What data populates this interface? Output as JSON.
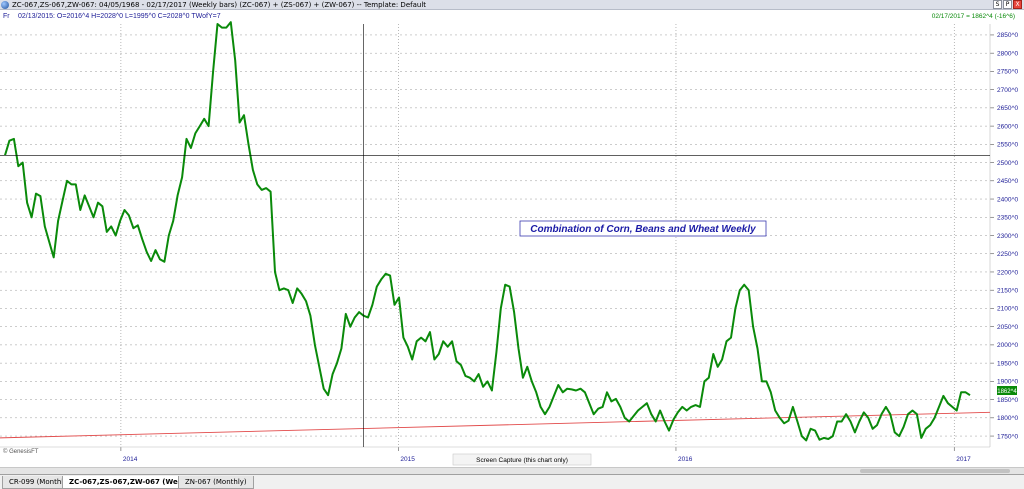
{
  "window": {
    "title": "ZC-067,ZS-067,ZW-067:  04/05/1968 - 02/17/2017  (Weekly bars)  (ZC-067) + (ZS-067) + (ZW-067)  --  Template: Default",
    "buttons": [
      "S",
      "P",
      "X"
    ]
  },
  "info_line": {
    "prefix": "Fr",
    "text": "02/13/2015:  O=2016^4  H=2028^0  L=1995^0  C=2028^0  TWofY=7"
  },
  "corner_readout": "02/17/2017 = 1862^4 (-16^6)",
  "last_price_label": "1862^4",
  "copyright": "© GenesisFT",
  "capture_tooltip": "Screen Capture (this chart only)",
  "tabs": [
    {
      "label": "CR-099 (Monthly)",
      "active": false
    },
    {
      "label": "ZC-067,ZS-067,ZW-067 (Weekly)",
      "active": true
    },
    {
      "label": "ZN-067 (Monthly)",
      "active": false
    }
  ],
  "colors": {
    "price_line": "#0a8a0a",
    "trend_line": "#e24b4b",
    "axis_text": "#1c1c96",
    "annotation_text": "#1a1aa6",
    "crosshair": "#000000"
  },
  "chart_data": {
    "type": "line",
    "title": "Combination of Corn, Beans and Wheat Weekly",
    "xlabel": "",
    "ylabel": "",
    "x_range": [
      "2013-07-26",
      "2017-02-17"
    ],
    "x_ticks": [
      "2014",
      "2015",
      "2016",
      "2017"
    ],
    "x_tick_dates": [
      "2014-01-01",
      "2015-01-01",
      "2016-01-01",
      "2017-01-01"
    ],
    "y_ticks": [
      "1750^0",
      "1800^0",
      "1850^0",
      "1900^0",
      "1950^0",
      "2000^0",
      "2050^0",
      "2100^0",
      "2150^0",
      "2200^0",
      "2250^0",
      "2300^0",
      "2350^0",
      "2400^0",
      "2450^0",
      "2500^0",
      "2550^0",
      "2600^0",
      "2650^0",
      "2700^0",
      "2750^0",
      "2800^0",
      "2850^0"
    ],
    "y_range": [
      1720,
      2880
    ],
    "grid": "dotted vertical at year starts, dashed horizontal at each tick",
    "crosshair": {
      "date": "2015-02-13",
      "value": 2520
    },
    "series": [
      {
        "values": [
          [
            "2013-07-26",
            2520
          ],
          [
            "2013-08-02",
            2560
          ],
          [
            "2013-08-09",
            2565
          ],
          [
            "2013-08-16",
            2490
          ],
          [
            "2013-08-23",
            2500
          ],
          [
            "2013-08-30",
            2390
          ],
          [
            "2013-09-06",
            2350
          ],
          [
            "2013-09-13",
            2415
          ],
          [
            "2013-09-20",
            2408
          ],
          [
            "2013-09-27",
            2325
          ],
          [
            "2013-10-04",
            2282
          ],
          [
            "2013-10-11",
            2240
          ],
          [
            "2013-10-18",
            2340
          ],
          [
            "2013-10-25",
            2395
          ],
          [
            "2013-11-01",
            2450
          ],
          [
            "2013-11-08",
            2440
          ],
          [
            "2013-11-15",
            2440
          ],
          [
            "2013-11-22",
            2370
          ],
          [
            "2013-11-29",
            2410
          ],
          [
            "2013-12-06",
            2380
          ],
          [
            "2013-12-13",
            2350
          ],
          [
            "2013-12-20",
            2390
          ],
          [
            "2013-12-27",
            2380
          ],
          [
            "2014-01-03",
            2310
          ],
          [
            "2014-01-10",
            2325
          ],
          [
            "2014-01-17",
            2300
          ],
          [
            "2014-01-24",
            2340
          ],
          [
            "2014-01-31",
            2370
          ],
          [
            "2014-02-07",
            2355
          ],
          [
            "2014-02-14",
            2320
          ],
          [
            "2014-02-21",
            2328
          ],
          [
            "2014-02-28",
            2290
          ],
          [
            "2014-03-07",
            2255
          ],
          [
            "2014-03-14",
            2230
          ],
          [
            "2014-03-21",
            2260
          ],
          [
            "2014-03-28",
            2235
          ],
          [
            "2014-04-04",
            2228
          ],
          [
            "2014-04-11",
            2300
          ],
          [
            "2014-04-18",
            2340
          ],
          [
            "2014-04-25",
            2410
          ],
          [
            "2014-05-02",
            2460
          ],
          [
            "2014-05-09",
            2565
          ],
          [
            "2014-05-16",
            2540
          ],
          [
            "2014-05-23",
            2580
          ],
          [
            "2014-05-30",
            2600
          ],
          [
            "2014-06-06",
            2620
          ],
          [
            "2014-06-13",
            2600
          ],
          [
            "2014-06-20",
            2750
          ],
          [
            "2014-06-27",
            2880
          ],
          [
            "2014-07-04",
            2870
          ],
          [
            "2014-07-11",
            2870
          ],
          [
            "2014-07-18",
            2885
          ],
          [
            "2014-07-25",
            2780
          ],
          [
            "2014-08-01",
            2610
          ],
          [
            "2014-08-08",
            2630
          ],
          [
            "2014-08-15",
            2550
          ],
          [
            "2014-08-22",
            2480
          ],
          [
            "2014-08-29",
            2440
          ],
          [
            "2014-09-05",
            2425
          ],
          [
            "2014-09-12",
            2430
          ],
          [
            "2014-09-19",
            2420
          ],
          [
            "2014-09-26",
            2200
          ],
          [
            "2014-10-03",
            2150
          ],
          [
            "2014-10-10",
            2155
          ],
          [
            "2014-10-17",
            2150
          ],
          [
            "2014-10-24",
            2115
          ],
          [
            "2014-10-31",
            2155
          ],
          [
            "2014-11-07",
            2140
          ],
          [
            "2014-11-14",
            2120
          ],
          [
            "2014-11-21",
            2080
          ],
          [
            "2014-11-28",
            2000
          ],
          [
            "2014-12-05",
            1940
          ],
          [
            "2014-12-12",
            1880
          ],
          [
            "2014-12-19",
            1862
          ],
          [
            "2014-12-26",
            1920
          ],
          [
            "2015-01-02",
            1950
          ],
          [
            "2015-01-09",
            1990
          ],
          [
            "2015-01-16",
            2085
          ],
          [
            "2015-01-23",
            2050
          ],
          [
            "2015-01-30",
            2075
          ],
          [
            "2015-02-06",
            2090
          ],
          [
            "2015-02-13",
            2080
          ],
          [
            "2015-02-20",
            2075
          ],
          [
            "2015-02-27",
            2110
          ],
          [
            "2015-03-06",
            2160
          ],
          [
            "2015-03-13",
            2180
          ],
          [
            "2015-03-20",
            2195
          ],
          [
            "2015-03-27",
            2190
          ],
          [
            "2015-04-03",
            2110
          ],
          [
            "2015-04-10",
            2130
          ],
          [
            "2015-04-17",
            2020
          ],
          [
            "2015-04-24",
            1995
          ],
          [
            "2015-05-01",
            1960
          ],
          [
            "2015-05-08",
            2010
          ],
          [
            "2015-05-15",
            2020
          ],
          [
            "2015-05-22",
            2010
          ],
          [
            "2015-05-29",
            2035
          ],
          [
            "2015-06-05",
            1960
          ],
          [
            "2015-06-12",
            1975
          ],
          [
            "2015-06-19",
            2010
          ],
          [
            "2015-06-26",
            1995
          ],
          [
            "2015-07-03",
            2010
          ],
          [
            "2015-07-10",
            1955
          ],
          [
            "2015-07-17",
            1945
          ],
          [
            "2015-07-24",
            1915
          ],
          [
            "2015-07-31",
            1910
          ],
          [
            "2015-08-07",
            1900
          ],
          [
            "2015-08-14",
            1920
          ],
          [
            "2015-08-21",
            1885
          ],
          [
            "2015-08-28",
            1900
          ],
          [
            "2015-09-04",
            1875
          ],
          [
            "2015-09-11",
            1980
          ],
          [
            "2015-09-18",
            2100
          ],
          [
            "2015-09-25",
            2165
          ],
          [
            "2015-10-02",
            2160
          ],
          [
            "2015-10-09",
            2090
          ],
          [
            "2015-10-16",
            1990
          ],
          [
            "2015-10-23",
            1910
          ],
          [
            "2015-10-30",
            1940
          ],
          [
            "2015-11-06",
            1900
          ],
          [
            "2015-11-13",
            1870
          ],
          [
            "2015-11-20",
            1830
          ],
          [
            "2015-11-27",
            1810
          ],
          [
            "2015-12-04",
            1830
          ],
          [
            "2015-12-11",
            1860
          ],
          [
            "2015-12-18",
            1890
          ],
          [
            "2015-12-25",
            1870
          ],
          [
            "2016-01-01",
            1880
          ],
          [
            "2016-01-08",
            1878
          ],
          [
            "2016-01-15",
            1875
          ],
          [
            "2016-01-22",
            1880
          ],
          [
            "2016-01-29",
            1870
          ],
          [
            "2016-02-05",
            1840
          ],
          [
            "2016-02-12",
            1810
          ],
          [
            "2016-02-19",
            1825
          ],
          [
            "2016-02-26",
            1830
          ],
          [
            "2016-03-04",
            1870
          ],
          [
            "2016-03-11",
            1845
          ],
          [
            "2016-03-18",
            1852
          ],
          [
            "2016-03-25",
            1830
          ],
          [
            "2016-04-01",
            1800
          ],
          [
            "2016-04-08",
            1790
          ],
          [
            "2016-04-15",
            1805
          ],
          [
            "2016-04-22",
            1820
          ],
          [
            "2016-04-29",
            1830
          ],
          [
            "2016-05-06",
            1840
          ],
          [
            "2016-05-13",
            1810
          ],
          [
            "2016-05-20",
            1790
          ],
          [
            "2016-05-27",
            1820
          ],
          [
            "2016-06-03",
            1790
          ],
          [
            "2016-06-10",
            1765
          ],
          [
            "2016-06-17",
            1795
          ],
          [
            "2016-06-24",
            1815
          ],
          [
            "2016-07-01",
            1830
          ],
          [
            "2016-07-08",
            1820
          ],
          [
            "2016-07-15",
            1830
          ],
          [
            "2016-07-22",
            1835
          ],
          [
            "2016-07-29",
            1830
          ],
          [
            "2016-08-05",
            1900
          ],
          [
            "2016-08-12",
            1910
          ],
          [
            "2016-08-19",
            1975
          ],
          [
            "2016-08-26",
            1940
          ],
          [
            "2016-09-02",
            1960
          ],
          [
            "2016-09-09",
            2010
          ],
          [
            "2016-09-16",
            2020
          ],
          [
            "2016-09-23",
            2100
          ],
          [
            "2016-09-30",
            2150
          ],
          [
            "2016-10-07",
            2165
          ],
          [
            "2016-10-14",
            2150
          ],
          [
            "2016-10-21",
            2050
          ],
          [
            "2016-10-28",
            1990
          ],
          [
            "2016-11-04",
            1900
          ],
          [
            "2016-11-11",
            1900
          ],
          [
            "2016-11-18",
            1870
          ],
          [
            "2016-11-25",
            1820
          ],
          [
            "2016-12-02",
            1800
          ],
          [
            "2016-12-09",
            1785
          ],
          [
            "2016-12-16",
            1792
          ],
          [
            "2016-12-23",
            1830
          ],
          [
            "2016-12-30",
            1790
          ],
          [
            "2017-01-06",
            1750
          ],
          [
            "2017-01-13",
            1738
          ],
          [
            "2017-01-20",
            1770
          ],
          [
            "2017-01-27",
            1765
          ],
          [
            "2017-02-03",
            1740
          ],
          [
            "2017-02-10",
            1745
          ],
          [
            "2017-02-17",
            1742
          ],
          [
            "2017-02-24",
            1750
          ],
          [
            "2017-03-03",
            1790
          ],
          [
            "2017-03-10",
            1790
          ],
          [
            "2017-03-17",
            1810
          ],
          [
            "2017-03-24",
            1790
          ],
          [
            "2017-03-31",
            1760
          ],
          [
            "2017-04-07",
            1790
          ],
          [
            "2017-04-14",
            1815
          ],
          [
            "2017-04-21",
            1800
          ],
          [
            "2017-04-28",
            1770
          ],
          [
            "2017-05-05",
            1780
          ],
          [
            "2017-05-12",
            1810
          ],
          [
            "2017-05-19",
            1830
          ],
          [
            "2017-05-26",
            1810
          ],
          [
            "2017-06-02",
            1760
          ],
          [
            "2017-06-09",
            1750
          ],
          [
            "2017-06-16",
            1775
          ],
          [
            "2017-06-23",
            1810
          ],
          [
            "2017-06-30",
            1820
          ],
          [
            "2017-07-07",
            1810
          ],
          [
            "2017-07-14",
            1745
          ],
          [
            "2017-07-21",
            1770
          ],
          [
            "2017-07-28",
            1780
          ],
          [
            "2017-08-04",
            1800
          ],
          [
            "2017-08-11",
            1830
          ],
          [
            "2017-08-18",
            1860
          ],
          [
            "2017-08-25",
            1840
          ],
          [
            "2017-09-01",
            1830
          ],
          [
            "2017-09-08",
            1820
          ],
          [
            "2017-09-15",
            1870
          ],
          [
            "2017-09-22",
            1870
          ],
          [
            "2017-09-29",
            1862
          ]
        ]
      }
    ],
    "trendline": {
      "start": [
        "2013-07-26",
        1745
      ],
      "end": [
        "2017-02-17",
        1815
      ]
    }
  }
}
